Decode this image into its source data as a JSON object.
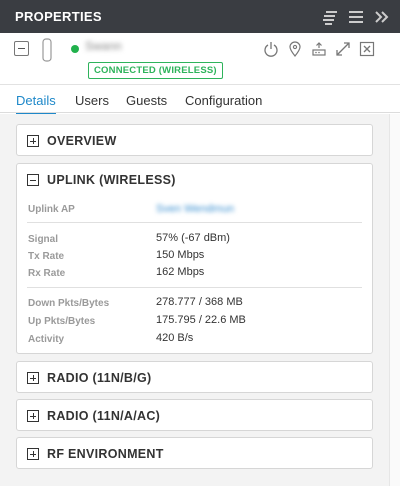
{
  "header": {
    "title": "PROPERTIES",
    "icons": [
      "list-align-icon",
      "menu-icon",
      "collapse-panel-icon"
    ]
  },
  "device": {
    "name": "Swann",
    "status_color": "#21b14c",
    "badge": "CONNECTED (WIRELESS)",
    "actions": [
      "restart-icon",
      "locate-icon",
      "device-manage-icon",
      "expand-icon",
      "close-icon"
    ]
  },
  "tabs": [
    "Details",
    "Users",
    "Guests",
    "Configuration"
  ],
  "active_tab": "Details",
  "sections": {
    "overview": {
      "title": "OVERVIEW",
      "expanded": false
    },
    "uplink": {
      "title": "UPLINK (WIRELESS)",
      "expanded": true,
      "uplink_ap_label": "Uplink AP",
      "uplink_ap_value": "Sven Wendmun",
      "signal_label": "Signal",
      "signal_value": "57% (-67 dBm)",
      "tx_label": "Tx Rate",
      "tx_value": "150 Mbps",
      "rx_label": "Rx Rate",
      "rx_value": "162 Mbps",
      "down_label": "Down Pkts/Bytes",
      "down_value": "278.777 / 368 MB",
      "up_label": "Up Pkts/Bytes",
      "up_value": "175.795 / 22.6 MB",
      "activity_label": "Activity",
      "activity_value": "420 B/s"
    },
    "radio_bg": {
      "title": "RADIO (11N/B/G)",
      "expanded": false
    },
    "radio_ac": {
      "title": "RADIO (11N/A/AC)",
      "expanded": false
    },
    "rf_env": {
      "title": "RF ENVIRONMENT",
      "expanded": false
    }
  },
  "colors": {
    "header_bg": "#3a3d42",
    "accent": "#1e88c9",
    "connected_green": "#2eb35b"
  }
}
